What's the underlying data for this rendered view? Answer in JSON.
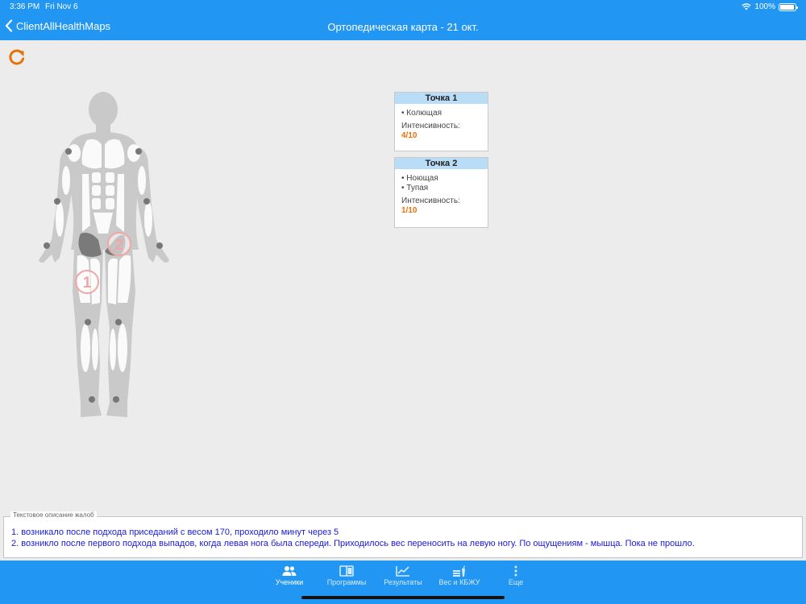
{
  "status_bar": {
    "time": "3:36 PM",
    "date": "Fri Nov 6",
    "battery": "100%"
  },
  "header": {
    "back_label": "ClientAllHealthMaps",
    "title": "Ортопедическая карта - 21 окт."
  },
  "points": [
    {
      "title": "Точка 1",
      "types": [
        "Колющая"
      ],
      "intensity_label": "Интенсивность:",
      "intensity_value": "4/10"
    },
    {
      "title": "Точка 2",
      "types": [
        "Ноющая",
        "Тупая"
      ],
      "intensity_label": "Интенсивность:",
      "intensity_value": "1/10"
    }
  ],
  "markers": [
    {
      "label": "1"
    },
    {
      "label": "2"
    }
  ],
  "description": {
    "legend": "Текстовое описание жалоб",
    "lines": [
      "1. возникало после подхода приседаний с весом 170, проходило минут через 5",
      "2. возникло после первого подхода выпадов, когда левая нога была спереди. Приходилось вес переносить на левую ногу. По ощущениям - мышца. Пока не прошло."
    ]
  },
  "tabs": [
    {
      "label": "Ученики",
      "icon": "people-icon",
      "active": true
    },
    {
      "label": "Программы",
      "icon": "book-icon",
      "active": false
    },
    {
      "label": "Результаты",
      "icon": "chart-icon",
      "active": false
    },
    {
      "label": "Вес и КБЖУ",
      "icon": "food-icon",
      "active": false
    },
    {
      "label": "Еще",
      "icon": "more-icon",
      "active": false
    }
  ],
  "colors": {
    "primary": "#2196f3",
    "accent": "#e8710a",
    "marker": "#f2a5a5",
    "card_header": "#b9dcf7",
    "description_text": "#1a1ad6"
  }
}
